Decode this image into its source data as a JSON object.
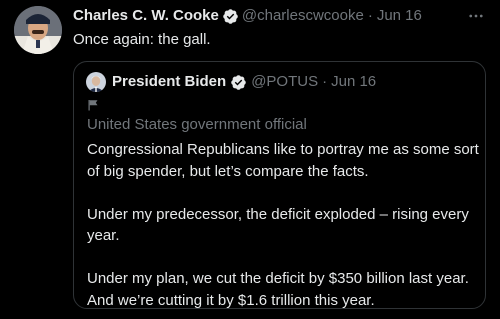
{
  "tweet": {
    "author_name": "Charles C. W. Cooke",
    "author_handle": "@charlescwcooke",
    "separator": "·",
    "date": "Jun 16",
    "text": "Once again: the gall.",
    "more_icon": "more-horizontal-icon",
    "verified_icon": "verified-badge-icon"
  },
  "quoted_tweet": {
    "author_name": "President Biden",
    "author_handle": "@POTUS",
    "separator": "·",
    "date": "Jun 16",
    "label": "United States government official",
    "label_icon": "flag-icon",
    "verified_icon": "verified-badge-icon",
    "paragraphs": [
      "Congressional Republicans like to portray me as some sort of big spender, but let’s compare the facts.",
      "Under my predecessor, the deficit exploded – rising every year.",
      "Under my plan, we cut the deficit by $350 billion last year. And we’re cutting it by $1.6 trillion this year."
    ]
  },
  "colors": {
    "background": "#000000",
    "primary_text": "#e7e9ea",
    "secondary_text": "#71767b",
    "border": "#2f3336",
    "badge": "#e7e9ea"
  }
}
